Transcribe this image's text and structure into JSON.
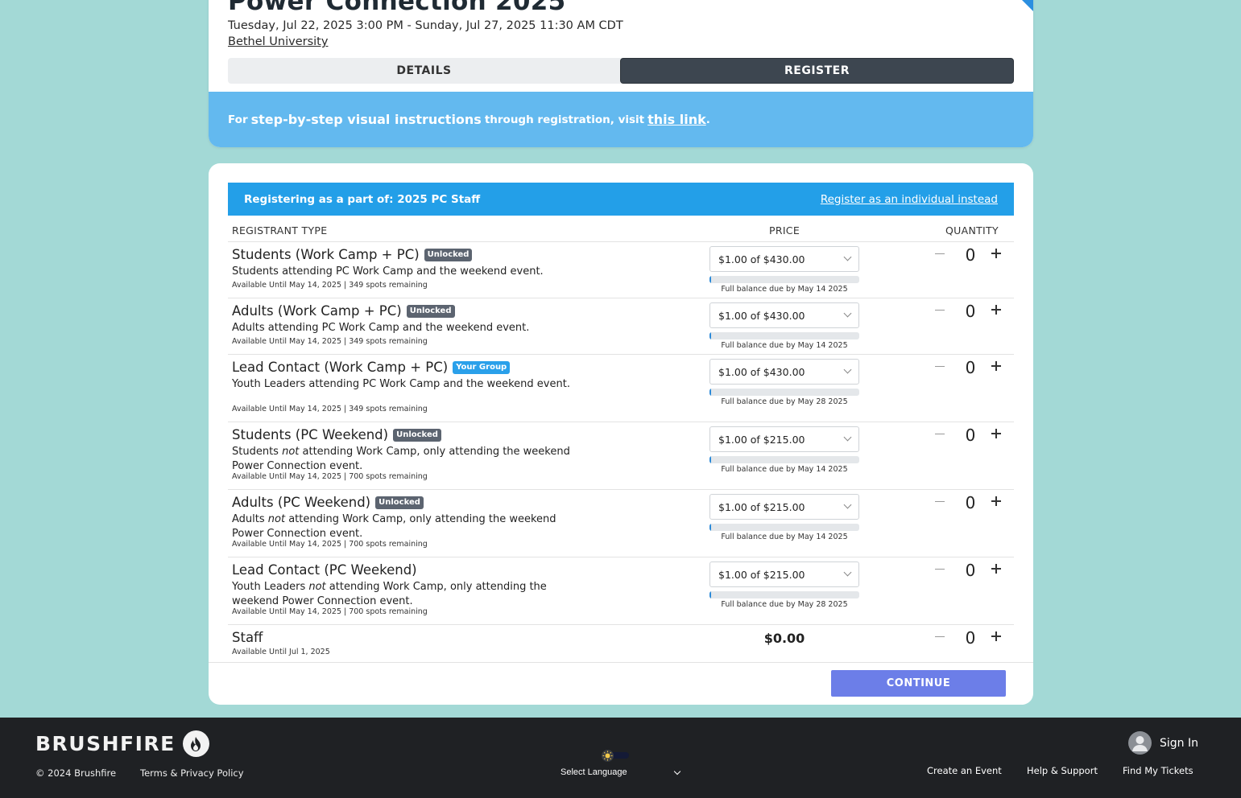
{
  "event": {
    "title": "Power Connection 2025",
    "dates": "Tuesday, Jul 22, 2025 3:00 PM - Sunday, Jul 27, 2025 11:30 AM CDT",
    "venue": "Bethel University"
  },
  "tabs": {
    "details": "DETAILS",
    "register": "REGISTER",
    "active": "REGISTER"
  },
  "instructions": {
    "prefix": "For",
    "emphasis": "step-by-step visual instructions",
    "middle": "through registration, visit",
    "link": "this link",
    "suffix": "."
  },
  "group_banner": {
    "label": "Registering as a part of: 2025 PC Staff",
    "switch_link": "Register as an individual instead"
  },
  "table": {
    "headers": {
      "type": "REGISTRANT TYPE",
      "price": "PRICE",
      "quantity": "QUANTITY"
    },
    "rows": [
      {
        "name": "Students (Work Camp + PC)",
        "badge": "Unlocked",
        "badge_color": "#5c6470",
        "desc_pre": "Students attending PC Work Camp and the weekend event.",
        "desc_em": "",
        "desc_post": "",
        "availability": "Available Until May 14, 2025 | 349 spots remaining",
        "price": "$1.00 of $430.00",
        "progress": 0.01,
        "due": "Full balance due by May 14 2025",
        "quantity": "0"
      },
      {
        "name": "Adults (Work Camp + PC)",
        "badge": "Unlocked",
        "badge_color": "#5c6470",
        "desc_pre": "Adults attending PC Work Camp and the weekend event.",
        "desc_em": "",
        "desc_post": "",
        "availability": "Available Until May 14, 2025 | 349 spots remaining",
        "price": "$1.00 of $430.00",
        "progress": 0.01,
        "due": "Full balance due by May 14 2025",
        "quantity": "0"
      },
      {
        "name": "Lead Contact (Work Camp + PC)",
        "badge": "Your Group",
        "badge_color": "#2aa0ea",
        "desc_pre": "Youth Leaders attending PC Work Camp and the weekend event.",
        "desc_em": "",
        "desc_post": "",
        "availability": "Available Until May 14, 2025 | 349 spots remaining",
        "price": "$1.00 of $430.00",
        "progress": 0.01,
        "due": "Full balance due by May 28 2025",
        "quantity": "0"
      },
      {
        "name": "Students (PC Weekend)",
        "badge": "Unlocked",
        "badge_color": "#5c6470",
        "desc_pre": "Students ",
        "desc_em": "not",
        "desc_post": " attending Work Camp, only attending the weekend Power Connection event.",
        "availability": "Available Until May 14, 2025 | 700 spots remaining",
        "price": "$1.00 of $215.00",
        "progress": 0.01,
        "due": "Full balance due by May 14 2025",
        "quantity": "0"
      },
      {
        "name": "Adults (PC Weekend)",
        "badge": "Unlocked",
        "badge_color": "#5c6470",
        "desc_pre": "Adults ",
        "desc_em": "not",
        "desc_post": " attending Work Camp, only attending the weekend Power Connection event.",
        "availability": "Available Until May 14, 2025 | 700 spots remaining",
        "price": "$1.00 of $215.00",
        "progress": 0.01,
        "due": "Full balance due by May 14 2025",
        "quantity": "0"
      },
      {
        "name": "Lead Contact (PC Weekend)",
        "badge": "",
        "badge_color": "",
        "desc_pre": "Youth Leaders ",
        "desc_em": "not",
        "desc_post": " attending Work Camp, only attending the weekend Power Connection event.",
        "availability": "Available Until May 14, 2025 | 700 spots remaining",
        "price": "$1.00 of $215.00",
        "progress": 0.01,
        "due": "Full balance due by May 28 2025",
        "quantity": "0"
      },
      {
        "name": "Staff",
        "badge": "",
        "badge_color": "",
        "desc_pre": "",
        "desc_em": "",
        "desc_post": "",
        "availability": "Available Until Jul 1, 2025",
        "fixed_price": "$0.00",
        "quantity": "0"
      }
    ]
  },
  "continue_label": "CONTINUE",
  "footer": {
    "brand": "BRUSHFIRE",
    "copyright": "© 2024 Brushfire",
    "privacy": "Terms & Privacy Policy",
    "language": "Select Language",
    "sign_in": "Sign In",
    "links": [
      "Create an Event",
      "Help & Support",
      "Find My Tickets"
    ]
  },
  "colors": {
    "page_bg": "#a3d9d6",
    "banner_blue": "#239fe8",
    "instructions_blue": "#63b9ef",
    "continue_button": "#6c7ee8",
    "footer_bg": "#1f2124"
  },
  "icons": {
    "brand_logo": "flame-icon",
    "theme_toggle": "sun-icon",
    "avatar": "user-avatar-icon",
    "select_caret": "chevron-down-icon"
  }
}
